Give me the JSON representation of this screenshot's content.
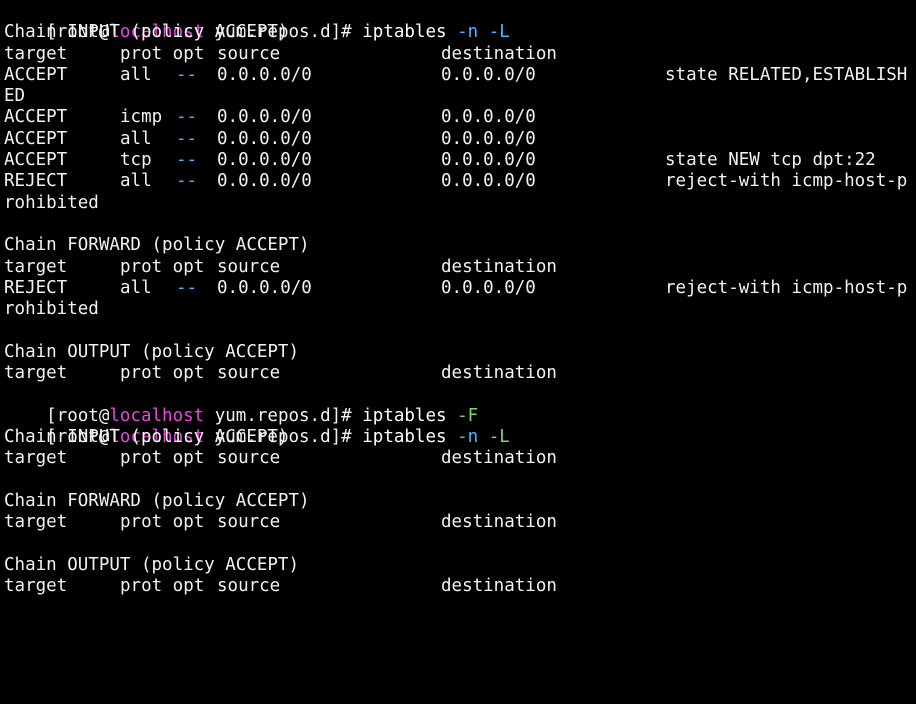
{
  "window": {
    "background": "#000000",
    "text_color": "#f2f2f2",
    "host_color": "#e649d8",
    "flag_color": "#4fb4ff",
    "flag_F_color": "#7fd66a"
  },
  "prompt": {
    "prefix": "[root@",
    "host": "localhost",
    "suffix": " yum.repos.d]# "
  },
  "commands": [
    {
      "cmd": "iptables",
      "flag1": " -n",
      "flag2": " -L"
    },
    {
      "cmd": "iptables",
      "flag1": " -F"
    },
    {
      "cmd": "iptables",
      "flag1": " -n",
      "flag2": " -L"
    }
  ],
  "headers": {
    "target": "target",
    "protopt": "prot opt",
    "source": "source",
    "destination": "destination"
  },
  "first_listing": {
    "input_chain": "Chain INPUT (policy ACCEPT)",
    "input_rules": [
      {
        "target": "ACCEPT",
        "prot": "all",
        "opt": "--",
        "source": "0.0.0.0/0",
        "destination": "0.0.0.0/0",
        "extra": "state RELATED,ESTABLISH",
        "wrap": "ED"
      },
      {
        "target": "ACCEPT",
        "prot": "icmp",
        "opt": "--",
        "source": "0.0.0.0/0",
        "destination": "0.0.0.0/0",
        "extra": "",
        "wrap": ""
      },
      {
        "target": "ACCEPT",
        "prot": "all",
        "opt": "--",
        "source": "0.0.0.0/0",
        "destination": "0.0.0.0/0",
        "extra": "",
        "wrap": ""
      },
      {
        "target": "ACCEPT",
        "prot": "tcp",
        "opt": "--",
        "source": "0.0.0.0/0",
        "destination": "0.0.0.0/0",
        "extra": "state NEW tcp dpt:22",
        "wrap": ""
      },
      {
        "target": "REJECT",
        "prot": "all",
        "opt": "--",
        "source": "0.0.0.0/0",
        "destination": "0.0.0.0/0",
        "extra": "reject-with icmp-host-p",
        "wrap": "rohibited"
      }
    ],
    "forward_chain": "Chain FORWARD (policy ACCEPT)",
    "forward_rules": [
      {
        "target": "REJECT",
        "prot": "all",
        "opt": "--",
        "source": "0.0.0.0/0",
        "destination": "0.0.0.0/0",
        "extra": "reject-with icmp-host-p",
        "wrap": "rohibited"
      }
    ],
    "output_chain": "Chain OUTPUT (policy ACCEPT)"
  },
  "second_listing": {
    "input_chain": "Chain INPUT (policy ACCEPT)",
    "forward_chain": "Chain FORWARD (policy ACCEPT)",
    "output_chain": "Chain OUTPUT (policy ACCEPT)"
  }
}
